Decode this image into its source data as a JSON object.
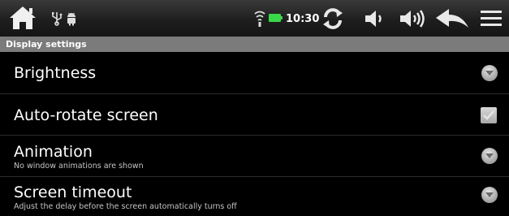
{
  "status_bar": {
    "time": "10:30",
    "icons": [
      "home-icon",
      "usb-icon",
      "android-debug-icon",
      "wifi-icon",
      "battery-icon",
      "refresh-icon",
      "volume-down-icon",
      "volume-up-icon",
      "back-icon",
      "menu-icon"
    ]
  },
  "header": {
    "title": "Display settings"
  },
  "settings": {
    "items": [
      {
        "title": "Brightness",
        "summary": "",
        "control": "dropdown"
      },
      {
        "title": "Auto-rotate screen",
        "summary": "",
        "control": "checkbox",
        "checked": true
      },
      {
        "title": "Animation",
        "summary": "No window animations are shown",
        "control": "dropdown"
      },
      {
        "title": "Screen timeout",
        "summary": "Adjust the delay before the screen automatically turns off",
        "control": "dropdown"
      }
    ]
  },
  "colors": {
    "status_bar": "#242424",
    "section_header": "#7b7b7b",
    "battery": "#39d84a",
    "text_primary": "#ffffff",
    "text_secondary": "#c4c4c4"
  }
}
